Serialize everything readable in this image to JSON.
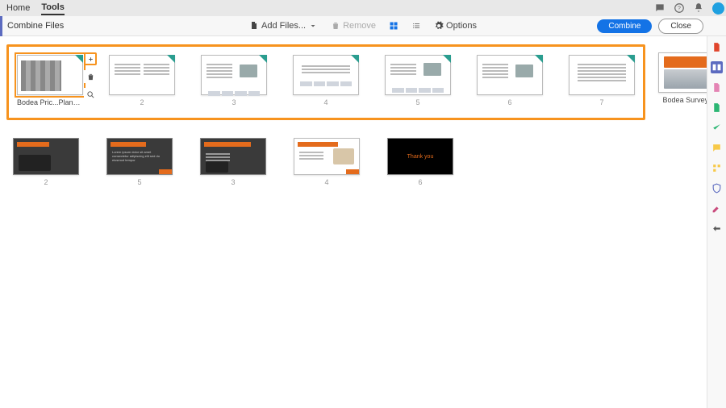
{
  "tabs": {
    "home": "Home",
    "tools": "Tools",
    "active": "tools"
  },
  "toolbar": {
    "title": "Combine Files",
    "add_files": "Add Files...",
    "remove": "Remove",
    "options": "Options",
    "combine": "Combine",
    "close": "Close"
  },
  "selection_group": {
    "first_item_caption": "Bodea Pric...Plans.ppt",
    "pages": [
      "2",
      "3",
      "4",
      "5",
      "6",
      "7"
    ]
  },
  "outside_item": {
    "caption": "Bodea Survey.pdf"
  },
  "row2_pages": [
    "2",
    "5",
    "3",
    "4",
    "6"
  ],
  "rail_tools": [
    "export-pdf",
    "combine-files",
    "edit-pdf",
    "create-pdf",
    "request-signatures",
    "comment",
    "organize-pages",
    "protect",
    "fill-sign",
    "more-tools"
  ]
}
